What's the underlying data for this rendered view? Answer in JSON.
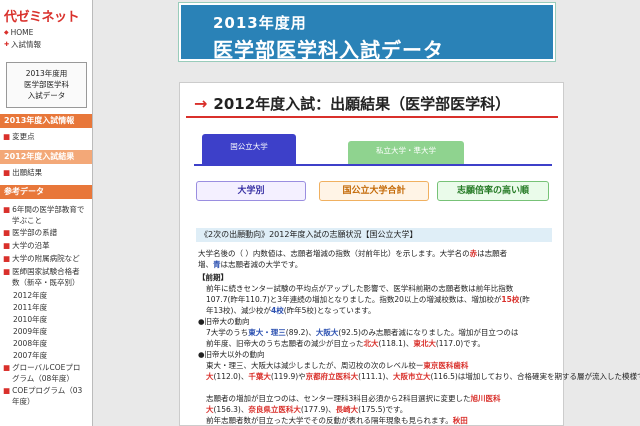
{
  "sidebar": {
    "logo": "代ゼミネット",
    "links": [
      {
        "label": "HOME",
        "icon": "home-icon"
      },
      {
        "label": "入試情報",
        "icon": "plus-icon"
      }
    ],
    "box_lines": [
      "2013年度用",
      "医学部医学科",
      "入試データ"
    ],
    "sections": [
      {
        "title": "2013年度入試情報"
      },
      {
        "title": "2012年度入試結果"
      },
      {
        "title": "参考データ"
      }
    ],
    "item_henko": "変更点",
    "item_shutsugan": "出願結果",
    "ref_items": [
      "6年間の医学部教育で",
      "学ぶこと",
      "医学部の系譜",
      "大学の沿革",
      "大学の附属病院など",
      "医師国家試験合格者",
      "数（新卒・既卒別）"
    ],
    "years": [
      "2012年度",
      "2011年度",
      "2010年度",
      "2009年度",
      "2008年度",
      "2007年度"
    ],
    "gp_items": [
      "グローバルCOEプロ",
      "グラム（08年度）",
      "COEプログラム（03",
      "年度）"
    ]
  },
  "banner": {
    "line1": "2013年度用",
    "line2": "医学部医学科入試データ"
  },
  "panel": {
    "title": "2012年度入試：出願結果（医学部医学科）",
    "tabs": [
      "国公立大学",
      "私立大学・準大学"
    ],
    "subtabs": [
      "大学別",
      "国公立大学合計",
      "志願倍率の高い順"
    ],
    "section_title": "《2次の出願動向》2012年度入試の志願状況【国公立大学】",
    "intro1": "大学名後の（  ）内数値は、志願者増減の指数（対前年比）を示します。大学名の",
    "intro1_red": "赤",
    "intro1_end": "は志願者",
    "intro2a": "増、",
    "intro2_blue": "青",
    "intro2b": "は志願者減の大学です。",
    "zenki": "【前期】",
    "p1": "前年に続きセンター試験の平均点がアップした影響で、医学科前期の志願者数は前年比指数",
    "p2": "107.7(昨年110.7)と3年連続の増加となりました。指数20以上の増減校数は、増加校が",
    "p2_red": "15校",
    "p2_end": "(昨",
    "p3": "年13校)、減少校が",
    "p3_blue": "4校",
    "p3_end": "(昨年5校)となっています。",
    "kyutei": "●旧帝大の動向",
    "k1a": "7大学のうち",
    "k1b": "東大・理三",
    "k1c": "(89.2)、",
    "k1d": "大阪大",
    "k1e": "(92.5)のみ志願者減になりました。増加が目立つのは",
    "k2a": "前年度、旧帝大のうち志願者の減少が目立った",
    "k2b": "北大",
    "k2c": "(118.1)、",
    "k2d": "東北大",
    "k2e": "(117.0)です。",
    "igai": "●旧帝大以外の動向",
    "m1a": "東大・理三、大阪大は減少しましたが、周辺校の次のレベル校ー",
    "m1b": "東京医科歯科",
    "m2a": "大",
    "m2b": "(112.0)、",
    "m2c": "千葉大",
    "m2d": "(119.9)や",
    "m2e": "京都府立医科大",
    "m2f": "(111.1)、",
    "m2g": "大阪市立大",
    "m2h": "(116.5)は増加しており、合格確実を期する層が流入した模様です。",
    "m3": "志願者の増加が目立つのは、センター理科3科目必須から2科目選択に変更した",
    "m3b": "旭川医科",
    "m4a": "大",
    "m4b": "(156.3)、",
    "m4c": "奈良県立医科大",
    "m4d": "(177.9)、",
    "m4e": "長崎大",
    "m4f": "(175.5)です。",
    "m5": "前年志願者数が目立った大学でその反動が表れる隔年現象も見られます。",
    "m5b": "秋田"
  },
  "colors": {
    "accent": "#d9302b",
    "banner": "#2a82b7",
    "tab_active": "#3d40c9",
    "tab_inactive": "#8fd38f"
  }
}
